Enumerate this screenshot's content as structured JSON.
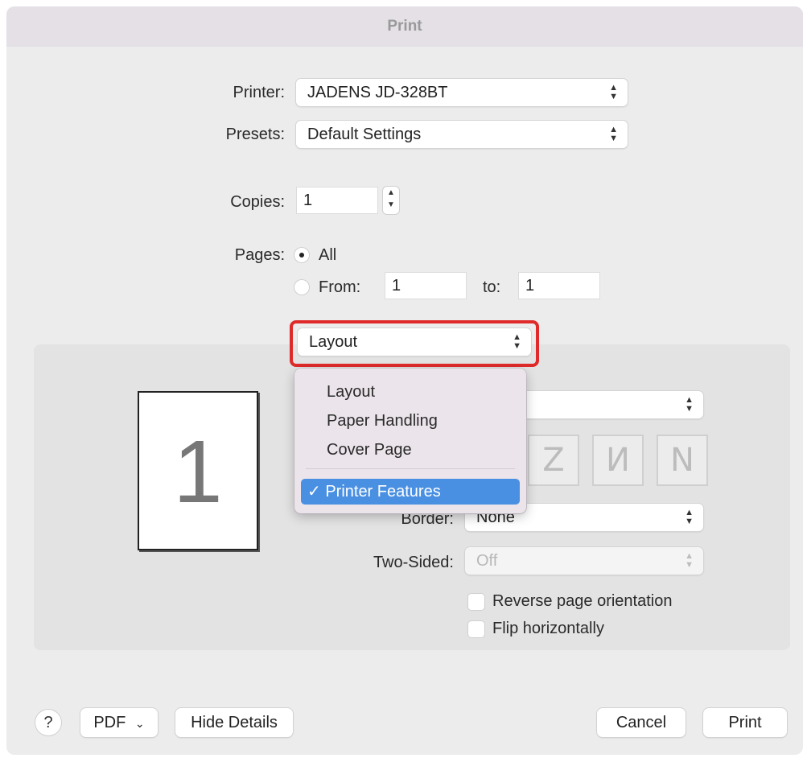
{
  "window": {
    "title": "Print"
  },
  "printer": {
    "label": "Printer:",
    "value": "JADENS JD-328BT"
  },
  "presets": {
    "label": "Presets:",
    "value": "Default Settings"
  },
  "copies": {
    "label": "Copies:",
    "value": "1"
  },
  "pages": {
    "label": "Pages:",
    "all_label": "All",
    "from_label": "From:",
    "from_value": "1",
    "to_label": "to:",
    "to_value": "1",
    "selected": "All"
  },
  "section_popup": {
    "value": "Layout"
  },
  "dropdown_menu": {
    "items": [
      "Layout",
      "Paper Handling",
      "Cover Page"
    ],
    "selected": "✓ Printer Features"
  },
  "preview": {
    "page_number": "1"
  },
  "layout_settings": {
    "layout_direction_icons": [
      "Z",
      "И",
      "N"
    ],
    "border_label": "Border:",
    "border_value": "None",
    "two_sided_label": "Two-Sided:",
    "two_sided_value": "Off",
    "reverse_label": "Reverse page orientation",
    "flip_label": "Flip horizontally"
  },
  "footer": {
    "help": "?",
    "pdf": "PDF",
    "pdf_chevron": "⌄",
    "hide_details": "Hide Details",
    "cancel": "Cancel",
    "print": "Print"
  },
  "chevrons": {
    "updown": "⌃⌄"
  },
  "colors": {
    "highlight": "#e02a2a",
    "accent": "#4a90e2"
  }
}
